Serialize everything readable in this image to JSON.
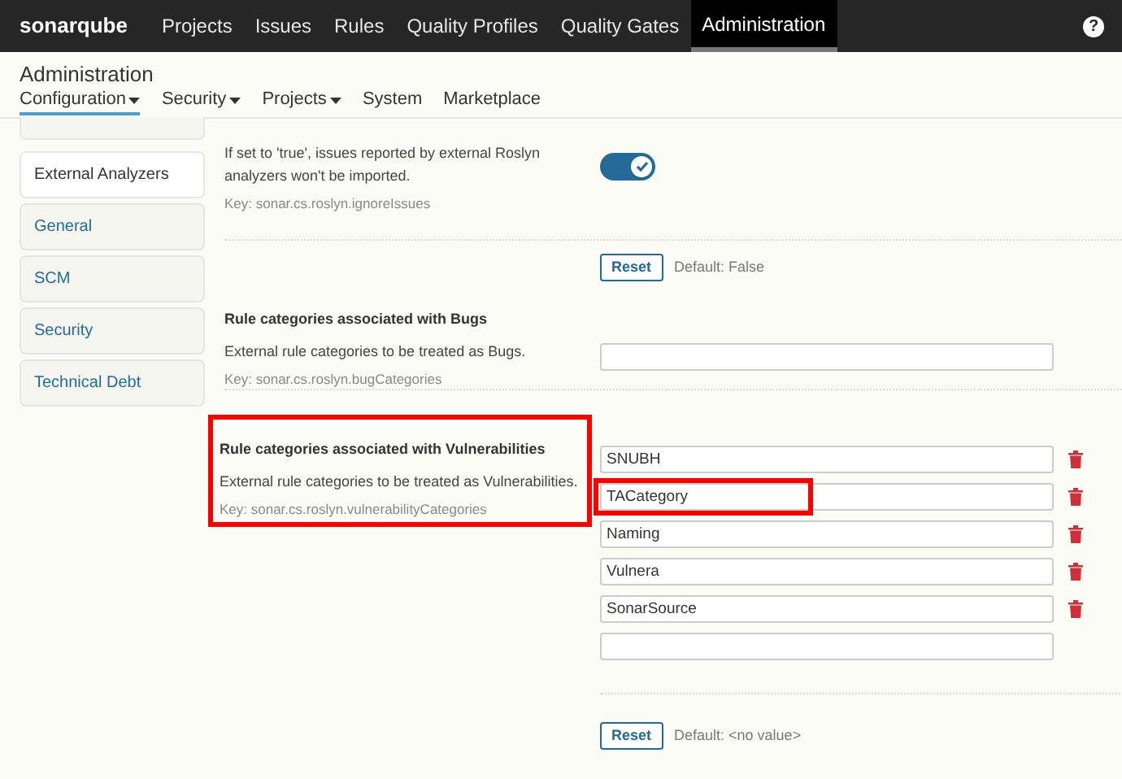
{
  "topbar": {
    "logo": "sonarqube",
    "nav": [
      {
        "label": "Projects",
        "selected": false
      },
      {
        "label": "Issues",
        "selected": false
      },
      {
        "label": "Rules",
        "selected": false
      },
      {
        "label": "Quality Profiles",
        "selected": false
      },
      {
        "label": "Quality Gates",
        "selected": false
      },
      {
        "label": "Administration",
        "selected": true
      }
    ],
    "help": "?"
  },
  "page_title": "Administration",
  "tabs": [
    {
      "label": "Configuration",
      "dropdown": true,
      "selected": true
    },
    {
      "label": "Security",
      "dropdown": true,
      "selected": false
    },
    {
      "label": "Projects",
      "dropdown": true,
      "selected": false
    },
    {
      "label": "System",
      "dropdown": false,
      "selected": false
    },
    {
      "label": "Marketplace",
      "dropdown": false,
      "selected": false
    }
  ],
  "sidebar": {
    "items": [
      {
        "label": "External Analyzers",
        "selected": true
      },
      {
        "label": "General",
        "selected": false
      },
      {
        "label": "SCM",
        "selected": false
      },
      {
        "label": "Security",
        "selected": false
      },
      {
        "label": "Technical Debt",
        "selected": false
      }
    ]
  },
  "settings": [
    {
      "kind": "toggle",
      "description": "If set to 'true', issues reported by external Roslyn analyzers won't be imported.",
      "key": "Key: sonar.cs.roslyn.ignoreIssues",
      "on": true,
      "reset": "Reset",
      "default": "Default: False"
    },
    {
      "kind": "text",
      "title": "Rule categories associated with Bugs",
      "description": "External rule categories to be treated as Bugs.",
      "key": "Key: sonar.cs.roslyn.bugCategories",
      "empty_field": true
    },
    {
      "kind": "list",
      "title": "Rule categories associated with Vulnerabilities",
      "description": "External rule categories to be treated as Vulnerabilities.",
      "key": "Key: sonar.cs.roslyn.vulnerabilityCategories",
      "highlighted": true,
      "values": [
        {
          "text": "SNUBH",
          "highlighted": false
        },
        {
          "text": "TACategory",
          "highlighted": true
        },
        {
          "text": "Naming",
          "highlighted": false
        },
        {
          "text": "Vulnera",
          "highlighted": false
        },
        {
          "text": "SonarSource",
          "highlighted": false
        }
      ],
      "empty_field": true,
      "reset": "Reset",
      "default": "Default: <no value>"
    }
  ]
}
